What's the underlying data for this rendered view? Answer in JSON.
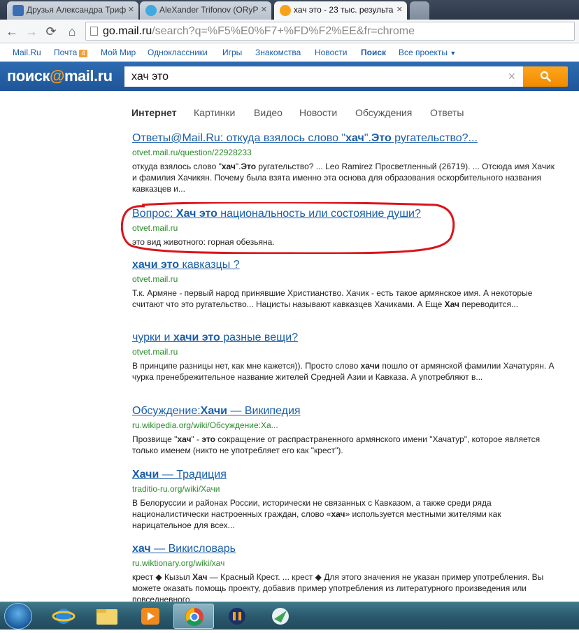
{
  "tabs": [
    {
      "label": "Друзья Александра Триф",
      "icon": "video-icon"
    },
    {
      "label": "AleXander Trifonov (ORyP",
      "icon": "twitter-icon"
    },
    {
      "label": "хач это - 23 тыс. результа",
      "icon": "mail-search-icon"
    }
  ],
  "address": {
    "host": "go.mail.ru",
    "rest": "/search?q=%F5%E0%F7+%FD%F2%EE&fr=chrome"
  },
  "portal": {
    "mailru": "Mail.Ru",
    "pochta": "Почта",
    "pochta_count": "4",
    "moimir": "Мой Мир",
    "ok": "Одноклассники",
    "games": "Игры",
    "dating": "Знакомства",
    "news": "Новости",
    "search": "Поиск",
    "all": "Все проекты"
  },
  "search": {
    "logo_left": "поиск",
    "logo_at": "@",
    "logo_right": "mail.ru",
    "query": "хач это"
  },
  "verticals": [
    "Интернет",
    "Картинки",
    "Видео",
    "Новости",
    "Обсуждения",
    "Ответы"
  ],
  "results": [
    {
      "title_parts": [
        "Ответы@Mail.Ru: откуда взялось слово \"",
        "хач",
        "\".",
        "Это",
        " ругательство?..."
      ],
      "url": "otvet.mail.ru/question/22928233",
      "snippet_parts": [
        "откуда взялось слово \"",
        "хач",
        "\".",
        "Это",
        " ругательство? ... Leo Ramirez Просветленный (26719). ... Отсюда имя Хачик и фамилия Хачикян. Почему была взята именно эта основа для образования оскорбительного названия кавказцев и..."
      ]
    },
    {
      "title_parts": [
        "Вопрос: ",
        "Хач это",
        " национальность или состояние души?"
      ],
      "url": "otvet.mail.ru",
      "snippet_parts": [
        "это вид животного: горная обезьяна."
      ]
    },
    {
      "title_parts": [
        "",
        "хачи это",
        " кавказцы ?"
      ],
      "url": "otvet.mail.ru",
      "snippet_parts": [
        "Т.к. Армяне - первый народ принявшие Христианство. Хачик - есть такое армянское имя. А некоторые считают что это ругательство... Нацисты называют кавказцев Хачиками. А Еще ",
        "Хач",
        " переводится..."
      ]
    },
    {
      "title_parts": [
        "чурки и ",
        "хачи это",
        " разные вещи?"
      ],
      "url": "otvet.mail.ru",
      "snippet_parts": [
        "В принципе разницы нет, как мне кажется)). Просто слово ",
        "хачи",
        " пошло от армянской фамилии Хачатурян. А чурка пренебрежительное название жителей Средней Азии и Кавказа. А употребляют в..."
      ]
    },
    {
      "title_parts": [
        "Обсуждение:",
        "Хачи",
        " — Википедия"
      ],
      "url": "ru.wikipedia.org/wiki/Обсуждение:Ха...",
      "snippet_parts": [
        "Прозвище \"",
        "хач",
        "\" - ",
        "это",
        " сокращение от распрастраненного армянского имени \"Хачатур\", которое является только именем (никто не употребляет его как \"крест\")."
      ]
    },
    {
      "title_parts": [
        "",
        "Хачи",
        " — Традиция"
      ],
      "url": "traditio-ru.org/wiki/Хачи",
      "snippet_parts": [
        "В Белоруссии и районах России, исторически не связанных с Кавказом, а также среди ряда националистически настроенных граждан, слово «",
        "хач",
        "» используется местными жителями как нарицательное для всех..."
      ]
    },
    {
      "title_parts": [
        "",
        "хач",
        " — Викисловарь"
      ],
      "url": "ru.wiktionary.org/wiki/хач",
      "snippet_parts": [
        "крест ◆ Кызыл ",
        "Хач",
        " — Красный Крест. ... крест ◆ Для этого значения не указан пример употребления. Вы можете оказать помощь проекту, добавив пример употребления из литературного произведения или повседневного..."
      ]
    }
  ],
  "taskbar": [
    "start-orb",
    "ie-icon",
    "explorer-icon",
    "media-player-icon",
    "chrome-icon",
    "audio-editor-icon",
    "network-app-icon"
  ],
  "colors": {
    "link": "#1a5ea8",
    "url_green": "#2c8a2c",
    "search_blue": "#2e6bb0",
    "search_orange": "#f39200",
    "annotation_red": "#d8151b"
  }
}
